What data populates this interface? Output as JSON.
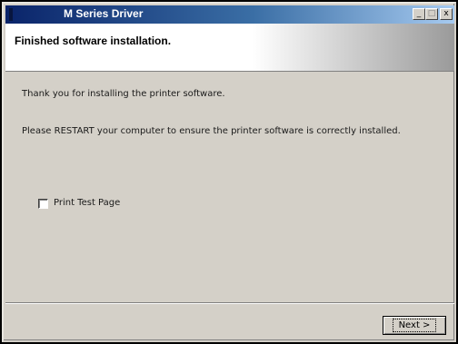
{
  "window": {
    "title": "M Series Driver",
    "controls": {
      "minimize": "_",
      "maximize": "□",
      "close": "x"
    }
  },
  "header": {
    "title": "Finished software installation."
  },
  "body": {
    "line1": "Thank you for installing the printer software.",
    "line2": "Please RESTART your computer to ensure the printer software is correctly installed."
  },
  "options": {
    "print_test_page_label": "Print Test Page",
    "print_test_page_checked": false
  },
  "footer": {
    "next_label": "Next >"
  }
}
